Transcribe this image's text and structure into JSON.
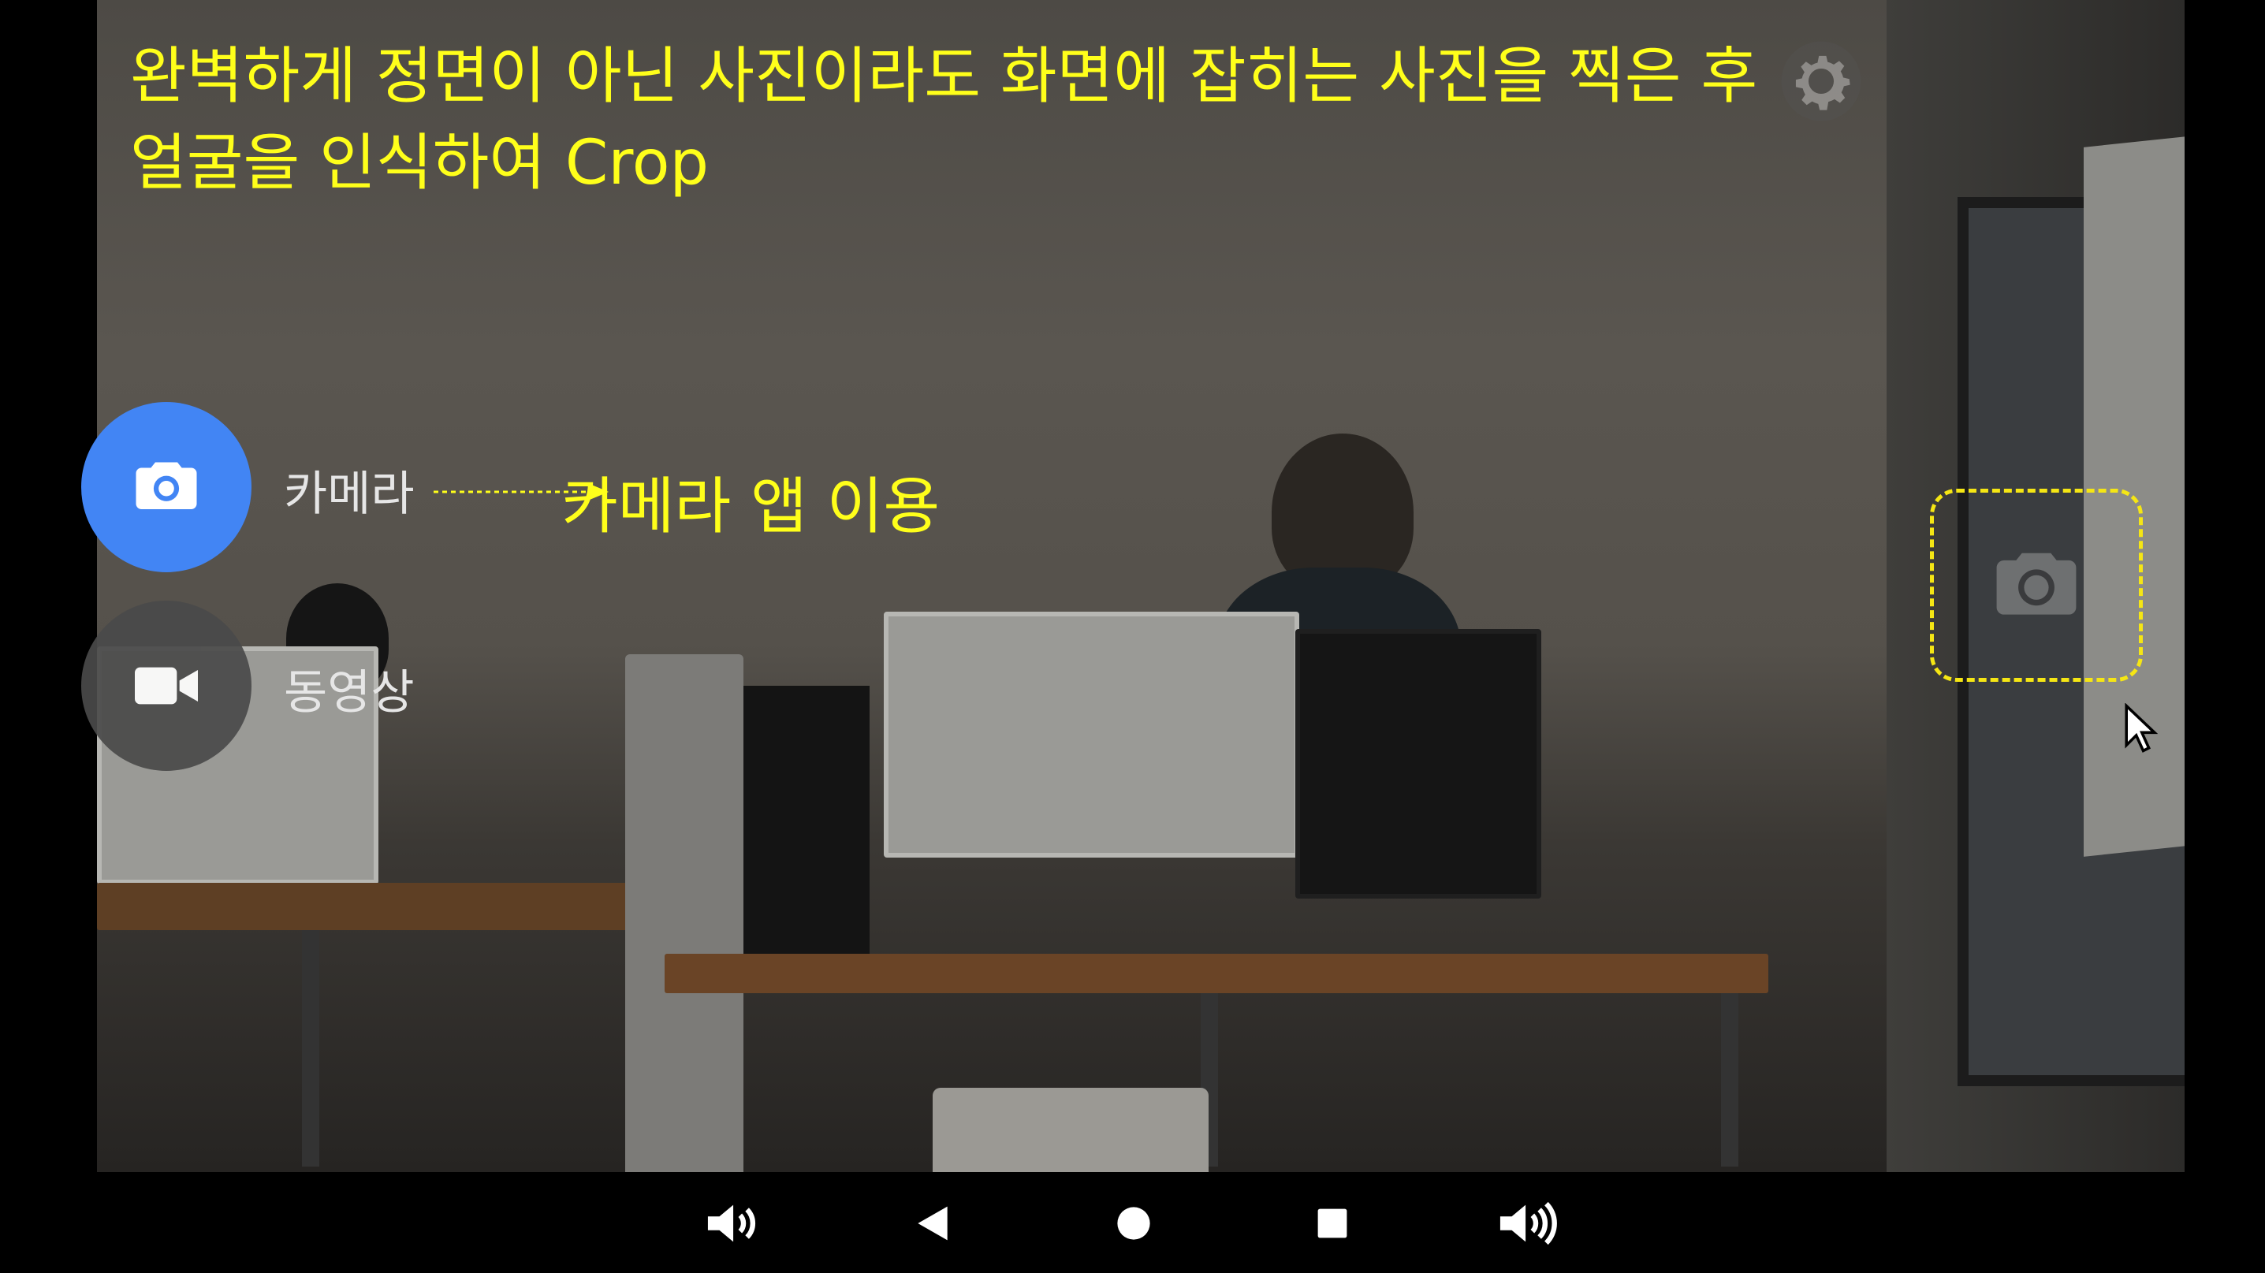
{
  "overlay": {
    "caption_line1": "완벽하게 정면이 아닌 사진이라도 화면에 잡히는 사진을 찍은 후",
    "caption_line2": "얼굴을 인식하여 Crop",
    "annotation": "카메라 앱 이용"
  },
  "modes": {
    "camera_label": "카메라",
    "video_label": "동영상"
  },
  "icons": {
    "camera_mode": "camera-icon",
    "video_mode": "video-camera-icon",
    "shutter": "camera-shutter-icon",
    "settings": "gear-icon",
    "cursor": "mouse-pointer-icon",
    "volume_down": "volume-down-icon",
    "back": "back-triangle-icon",
    "home": "home-circle-icon",
    "recents": "recents-square-icon",
    "volume_up": "volume-up-icon"
  },
  "colors": {
    "caption": "#ffff1a",
    "camera_button": "#4285f4",
    "video_button": "#4a4a4a",
    "highlight_border": "#f5e614",
    "navbar": "#000000"
  }
}
